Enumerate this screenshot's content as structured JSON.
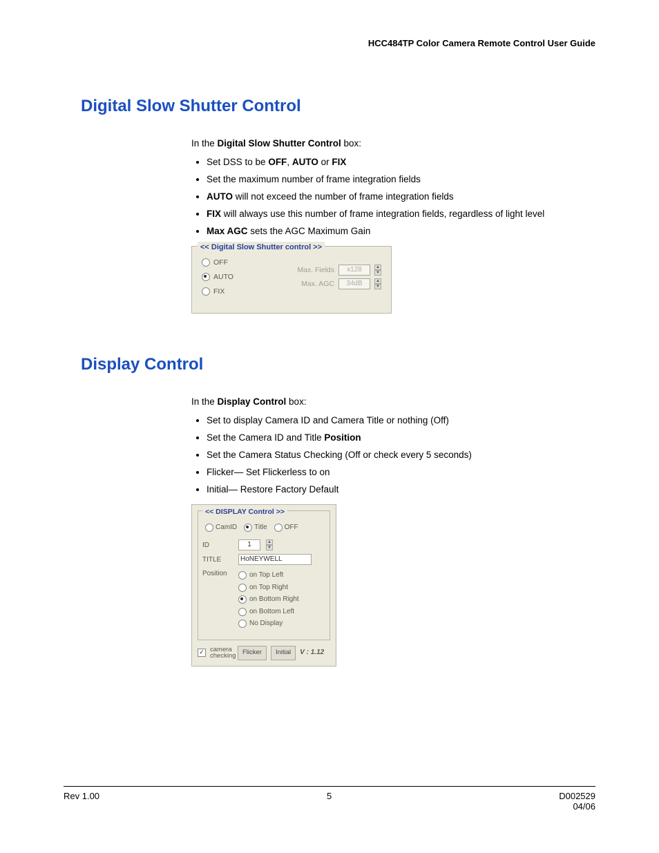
{
  "header": {
    "title": "HCC484TP Color Camera Remote Control User Guide"
  },
  "section1": {
    "heading": "Digital Slow Shutter Control",
    "intro_pre": "In the ",
    "intro_bold": "Digital Slow Shutter Control",
    "intro_post": " box:",
    "b1_pre": "Set DSS to be ",
    "b1_b1": "OFF",
    "b1_mid1": ", ",
    "b1_b2": "AUTO",
    "b1_mid2": " or ",
    "b1_b3": "FIX",
    "b2": "Set the maximum number of frame integration fields",
    "b3_b": "AUTO",
    "b3_post": " will not exceed the number of frame integration fields",
    "b4_b": "FIX",
    "b4_post": " will always use this number of frame integration fields, regardless of light level",
    "b5_b": "Max AGC",
    "b5_post": " sets the AGC Maximum Gain",
    "panel": {
      "legend": "<< Digital Slow Shutter control >>",
      "opt_off": "OFF",
      "opt_auto": "AUTO",
      "opt_fix": "FIX",
      "max_fields_label": "Max. Fields",
      "max_fields_value": "x128",
      "max_agc_label": "Max. AGC",
      "max_agc_value": "34dB"
    }
  },
  "section2": {
    "heading": "Display Control",
    "intro_pre": "In the ",
    "intro_bold": "Display Control",
    "intro_post": " box:",
    "b1": "Set to display Camera ID and Camera Title or nothing (Off)",
    "b2_pre": "Set the Camera ID and Title ",
    "b2_b": "Position",
    "b3": "Set the Camera Status Checking (Off or check every 5 seconds)",
    "b4": "Flicker— Set Flickerless to on",
    "b5": "Initial— Restore Factory Default",
    "panel": {
      "legend": "<< DISPLAY Control >>",
      "opt_camid": "CamID",
      "opt_title": "Title",
      "opt_off": "OFF",
      "id_label": "ID",
      "id_value": "1",
      "title_label": "TITLE",
      "title_value": "HoNEYWELL",
      "position_label": "Position",
      "pos1": "on Top Left",
      "pos2": "on Top Right",
      "pos3": "on Bottom Right",
      "pos4": "on Bottom Left",
      "pos5": "No Display",
      "camera_checking": "camera checking",
      "flicker_btn": "Flicker",
      "initial_btn": "Initial",
      "version": "V : 1.12"
    }
  },
  "footer": {
    "left": "Rev 1.00",
    "center": "5",
    "right1": "D002529",
    "right2": "04/06"
  }
}
